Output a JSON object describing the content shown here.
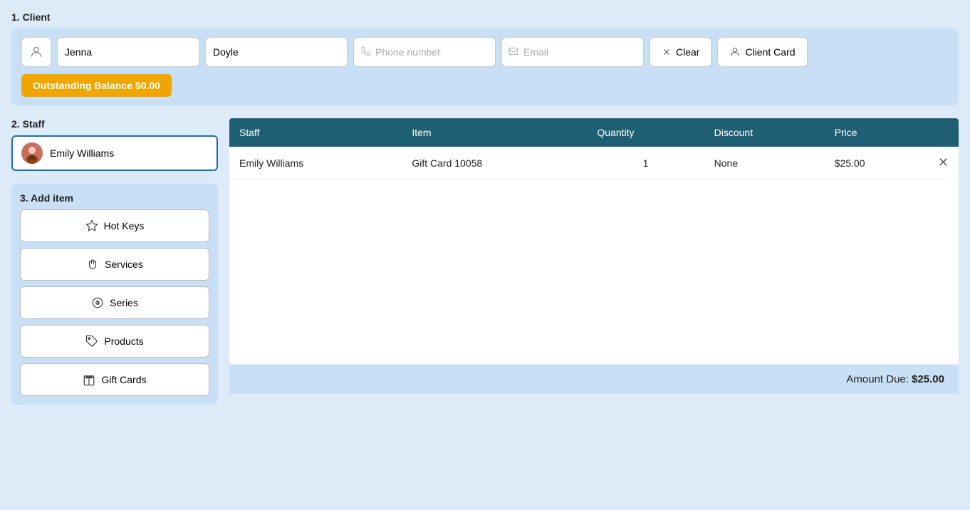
{
  "sections": {
    "client": {
      "label": "1. Client",
      "firstName": "Jenna",
      "lastName": "Doyle",
      "phonePlaceholder": "Phone number",
      "emailPlaceholder": "Email",
      "clearLabel": "Clear",
      "clientCardLabel": "Client Card",
      "outstandingBalanceLabel": "Outstanding Balance $0.00"
    },
    "staff": {
      "label": "2. Staff",
      "staffName": "Emily Williams"
    },
    "addItem": {
      "label": "3. Add item",
      "buttons": [
        {
          "id": "hot-keys",
          "label": "Hot Keys",
          "icon": "star"
        },
        {
          "id": "services",
          "label": "Services",
          "icon": "hand"
        },
        {
          "id": "series",
          "label": "Series",
          "icon": "gift-box"
        },
        {
          "id": "products",
          "label": "Products",
          "icon": "tag"
        },
        {
          "id": "gift-cards",
          "label": "Gift Cards",
          "icon": "gift"
        }
      ]
    },
    "invoice": {
      "columns": [
        "Staff",
        "Item",
        "Quantity",
        "Discount",
        "Price",
        ""
      ],
      "rows": [
        {
          "staff": "Emily Williams",
          "item": "Gift Card 10058",
          "quantity": "1",
          "discount": "None",
          "price": "$25.00"
        }
      ],
      "amountDueLabel": "Amount Due:",
      "amountDueValue": "$25.00"
    }
  }
}
